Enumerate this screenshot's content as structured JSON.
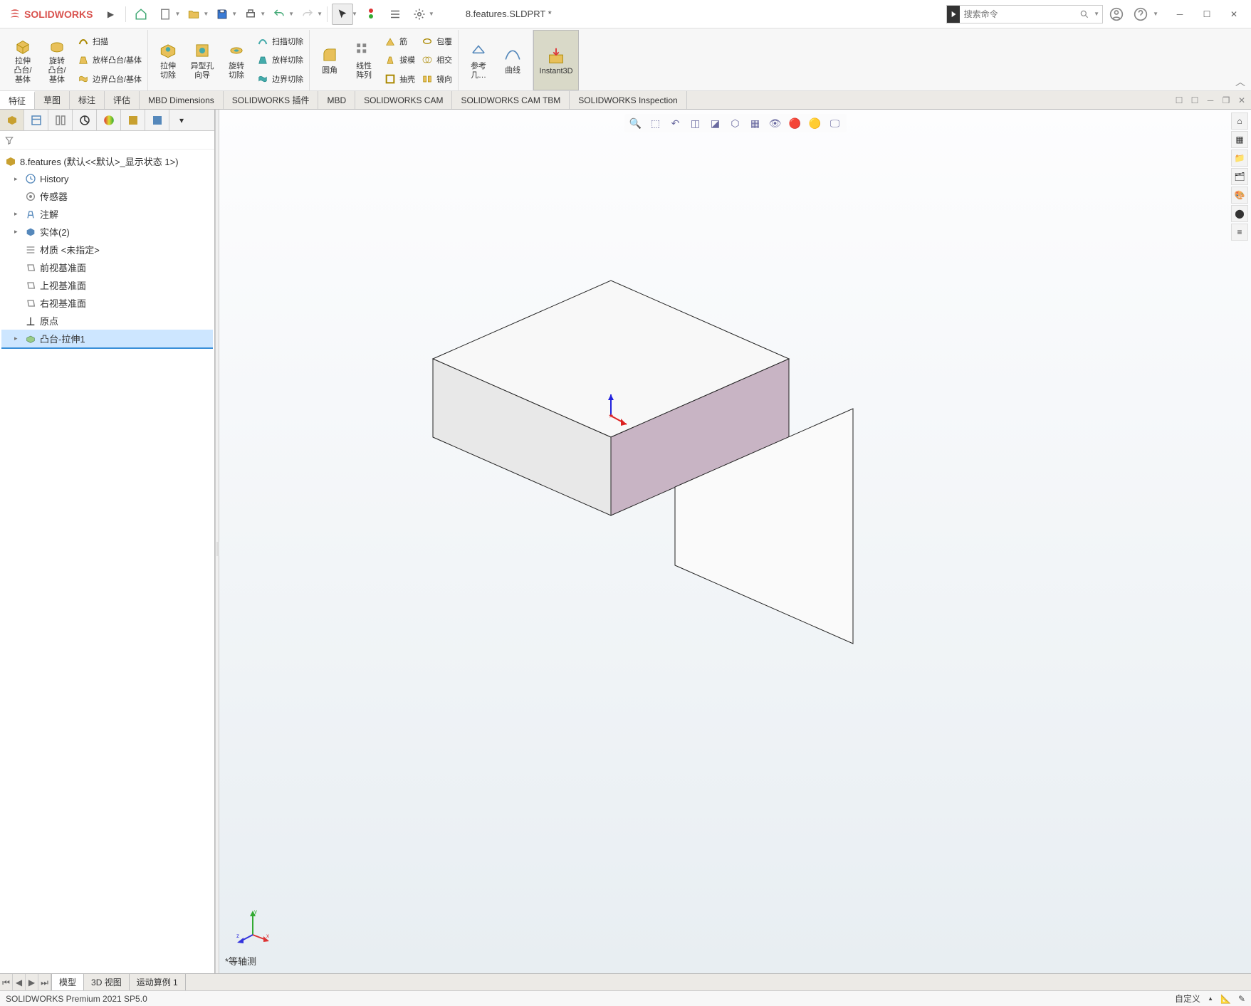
{
  "app": {
    "name": "SOLIDWORKS",
    "doc_title": "8.features.SLDPRT *"
  },
  "search": {
    "placeholder": "搜索命令"
  },
  "ribbon": {
    "g1": {
      "extrude": "拉伸\n凸台/\n基体",
      "revolve": "旋转\n凸台/\n基体",
      "sweep": "扫描",
      "loft": "放样凸台/基体",
      "boundary": "边界凸台/基体"
    },
    "g2": {
      "excut": "拉伸\n切除",
      "hole": "异型孔\n向导",
      "revcut": "旋转\n切除",
      "sweepcut": "扫描切除",
      "loftcut": "放样切除",
      "boundcut": "边界切除"
    },
    "g3": {
      "fillet": "圆角",
      "pattern": "线性\n阵列",
      "rib": "筋",
      "draft": "拔模",
      "shell": "抽壳",
      "wrap": "包覆",
      "intersect": "相交",
      "mirror": "镜向"
    },
    "g4": {
      "refgeo": "参考\n几…",
      "curve": "曲线"
    },
    "instant3d": "Instant3D"
  },
  "tabs": [
    "特征",
    "草图",
    "标注",
    "评估",
    "MBD Dimensions",
    "SOLIDWORKS 插件",
    "MBD",
    "SOLIDWORKS CAM",
    "SOLIDWORKS CAM TBM",
    "SOLIDWORKS Inspection"
  ],
  "tree": {
    "root": "8.features  (默认<<默认>_显示状态 1>)",
    "items": [
      {
        "label": "History",
        "exp": true
      },
      {
        "label": "传感器",
        "exp": false
      },
      {
        "label": "注解",
        "exp": true
      },
      {
        "label": "实体(2)",
        "exp": true
      },
      {
        "label": "材质 <未指定>",
        "exp": false
      },
      {
        "label": "前视基准面",
        "exp": false
      },
      {
        "label": "上视基准面",
        "exp": false
      },
      {
        "label": "右视基准面",
        "exp": false
      },
      {
        "label": "原点",
        "exp": false
      },
      {
        "label": "凸台-拉伸1",
        "exp": true,
        "sel": true
      }
    ]
  },
  "view": {
    "label": "*等轴测",
    "triad_x": "x",
    "triad_y": "y",
    "triad_z": "z"
  },
  "bottom_tabs": [
    "模型",
    "3D 视图",
    "运动算例 1"
  ],
  "status": {
    "left": "SOLIDWORKS Premium 2021 SP5.0",
    "right": "自定义"
  }
}
